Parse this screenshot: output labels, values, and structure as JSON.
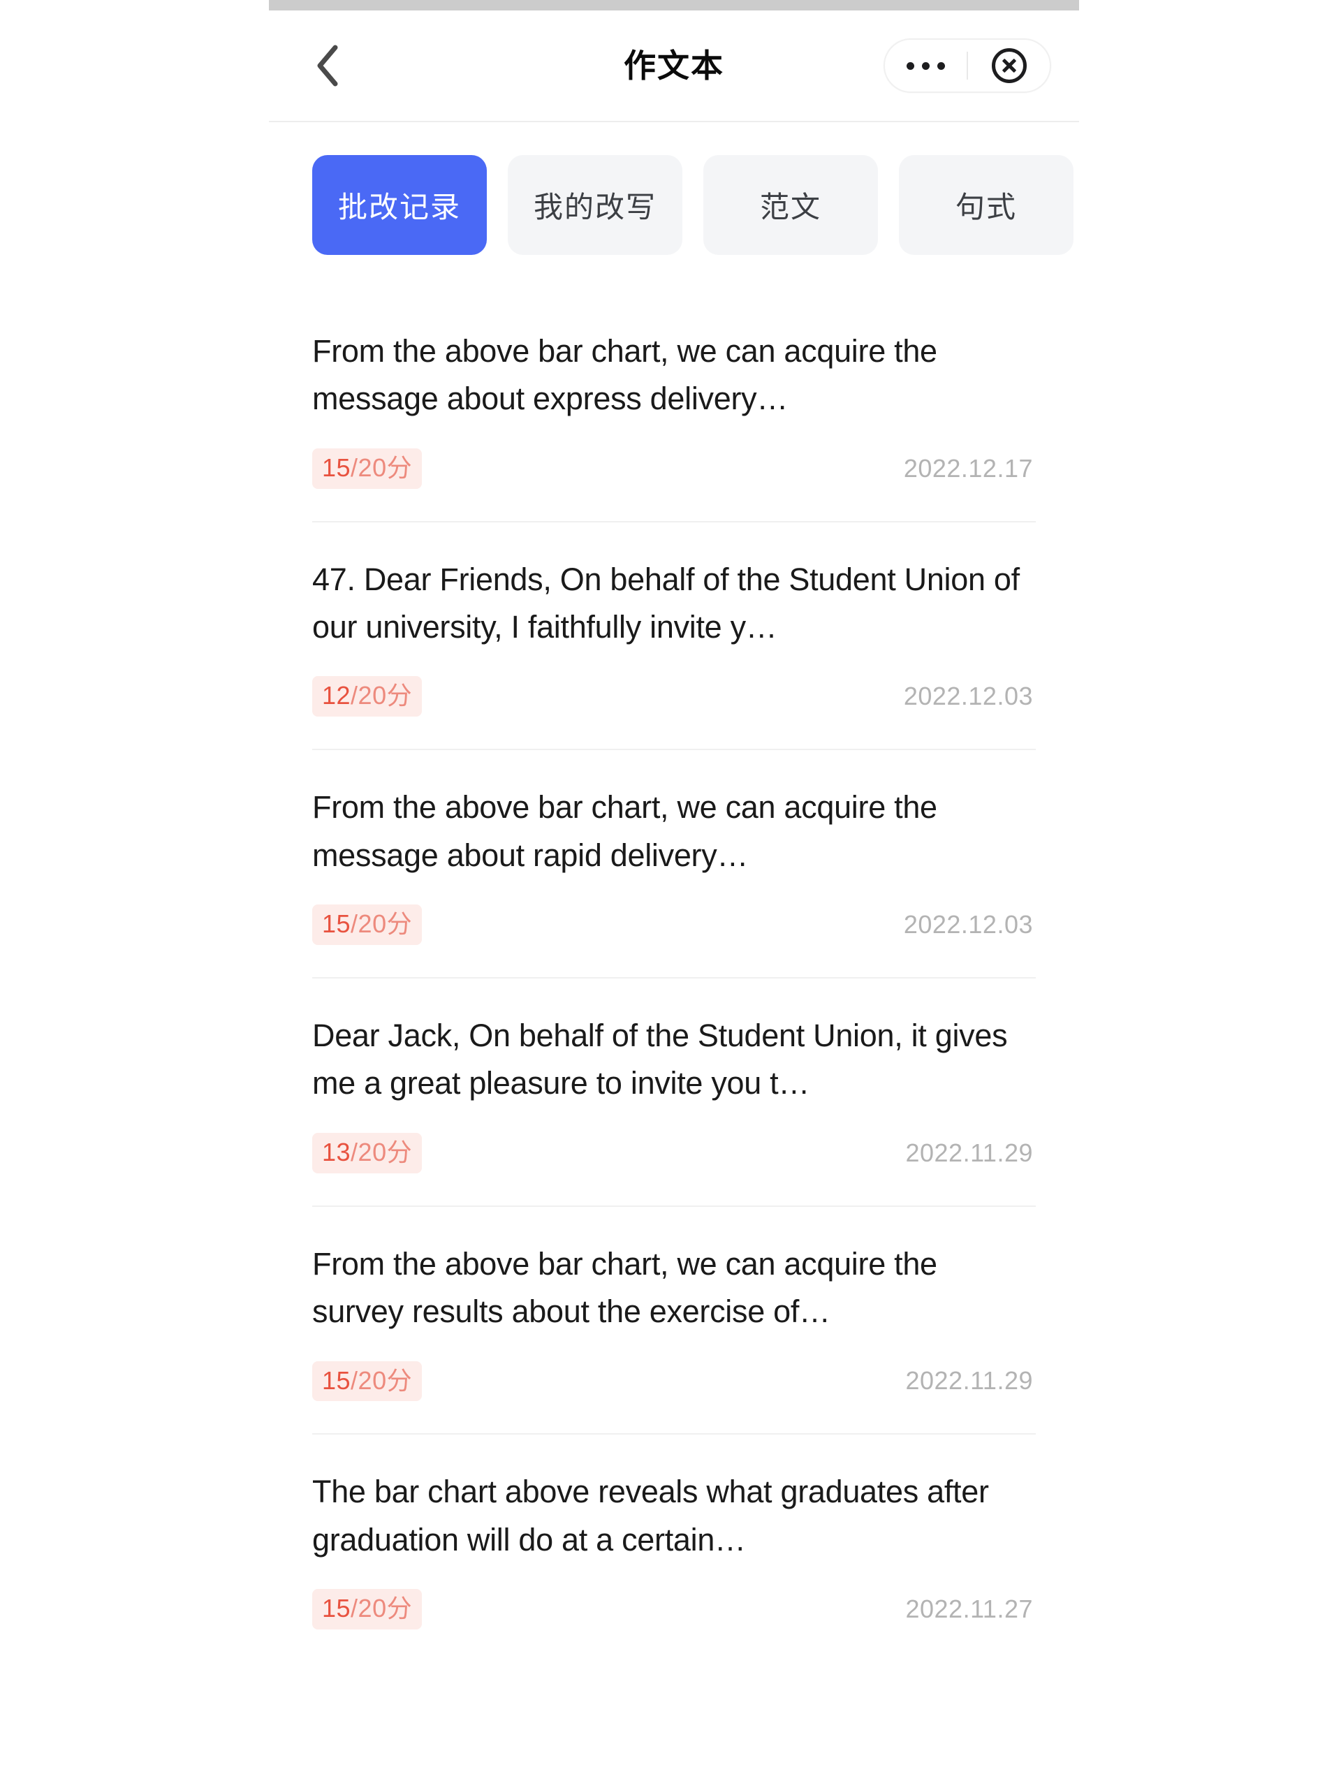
{
  "header": {
    "back_icon": "chevron-left-icon",
    "title": "作文本",
    "capsule": {
      "more_icon": "more-horizontal-icon",
      "close_icon": "close-circle-icon"
    }
  },
  "tabs": [
    {
      "label": "批改记录",
      "active": true
    },
    {
      "label": "我的改写",
      "active": false
    },
    {
      "label": "范文",
      "active": false
    },
    {
      "label": "句式",
      "active": false
    }
  ],
  "list": [
    {
      "title": "From the above bar chart, we can acquire the message about express delivery…",
      "score_value": "15",
      "score_total": "/20分",
      "date": "2022.12.17"
    },
    {
      "title": "47. Dear Friends, On behalf of the Student Union of our university, I faithfully invite y…",
      "score_value": "12",
      "score_total": "/20分",
      "date": "2022.12.03"
    },
    {
      "title": "From the above bar chart, we can acquire the message about rapid delivery…",
      "score_value": "15",
      "score_total": "/20分",
      "date": "2022.12.03"
    },
    {
      "title": "Dear Jack, On behalf of the Student Union, it gives me a great pleasure to invite you t…",
      "score_value": "13",
      "score_total": "/20分",
      "date": "2022.11.29"
    },
    {
      "title": "From the above bar chart, we can acquire the survey results about the exercise of…",
      "score_value": "15",
      "score_total": "/20分",
      "date": "2022.11.29"
    },
    {
      "title": "The bar chart above reveals what graduates after graduation will do at a certain…",
      "score_value": "15",
      "score_total": "/20分",
      "date": "2022.11.27"
    }
  ],
  "colors": {
    "accent": "#4a69f5",
    "tab_inactive_bg": "#f4f5f7",
    "badge_bg": "#fdece9",
    "badge_value": "#e8523f",
    "badge_total": "#ed8a7d",
    "date_text": "#b3b3b3",
    "status_bar": "#cccccc"
  }
}
